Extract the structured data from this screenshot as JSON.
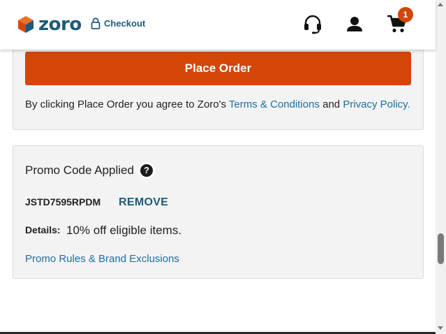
{
  "header": {
    "logo_text": "zoro",
    "checkout_label": "Checkout",
    "cart_count": "1",
    "icons": [
      "zoro-cube-logo",
      "lock-icon",
      "headset-icon",
      "account-icon",
      "cart-icon"
    ]
  },
  "order": {
    "place_order_label": "Place Order",
    "agree_prefix": "By clicking Place Order you agree to Zoro's ",
    "terms_link": "Terms & Conditions",
    "and_text": " and ",
    "privacy_link": "Privacy Policy."
  },
  "promo": {
    "title": "Promo Code Applied",
    "help_glyph": "?",
    "code": "JSTD7595RPDM",
    "remove_label": "REMOVE",
    "details_label": "Details:",
    "details_value": "10% off eligible items.",
    "rules_link": "Promo Rules & Brand Exclusions"
  },
  "colors": {
    "brand_orange": "#d34608",
    "brand_blue": "#1f5a7a",
    "link_blue": "#1c6fa3",
    "card_bg": "#f3f3f3"
  }
}
